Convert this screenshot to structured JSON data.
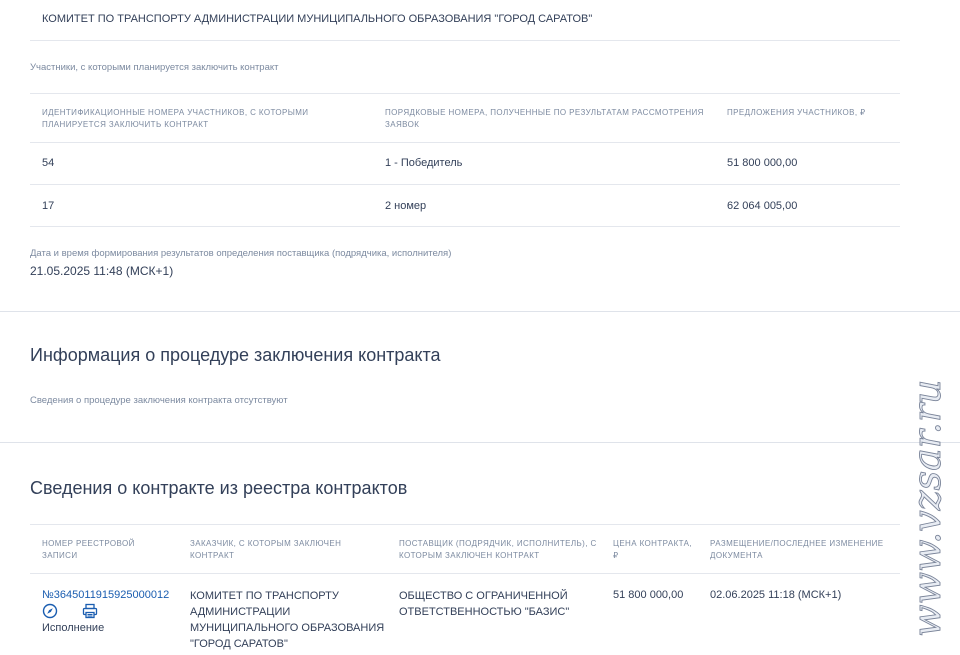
{
  "customer": {
    "name": "КОМИТЕТ ПО ТРАНСПОРТУ АДМИНИСТРАЦИИ МУНИЦИПАЛЬНОГО ОБРАЗОВАНИЯ \"ГОРОД САРАТОВ\""
  },
  "participants": {
    "section_label": "Участники, с которыми планируется заключить контракт",
    "columns": [
      "ИДЕНТИФИКАЦИОННЫЕ НОМЕРА УЧАСТНИКОВ, С КОТОРЫМИ ПЛАНИРУЕТСЯ ЗАКЛЮЧИТЬ КОНТРАКТ",
      "ПОРЯДКОВЫЕ НОМЕРА, ПОЛУЧЕННЫЕ ПО РЕЗУЛЬТАТАМ РАССМОТРЕНИЯ ЗАЯВОК",
      "ПРЕДЛОЖЕНИЯ УЧАСТНИКОВ, ₽"
    ],
    "rows": [
      {
        "id": "54",
        "order": "1 - Победитель",
        "offer": "51 800 000,00"
      },
      {
        "id": "17",
        "order": "2 номер",
        "offer": "62 064 005,00"
      }
    ]
  },
  "results": {
    "label": "Дата и время формирования результатов определения поставщика (подрядчика, исполнителя)",
    "value": "21.05.2025 11:48 (МСК+1)"
  },
  "procedure": {
    "title": "Информация о процедуре заключения контракта",
    "note": "Сведения о процедуре заключения контракта отсутствуют"
  },
  "registry": {
    "title": "Сведения о контракте из реестра контрактов",
    "columns": [
      "НОМЕР РЕЕСТРОВОЙ ЗАПИСИ",
      "ЗАКАЗЧИК, С КОТОРЫМ ЗАКЛЮЧЕН КОНТРАКТ",
      "ПОСТАВЩИК (ПОДРЯДЧИК, ИСПОЛНИТЕЛЬ), С КОТОРЫМ ЗАКЛЮЧЕН КОНТРАКТ",
      "ЦЕНА КОНТРАКТА, ₽",
      "РАЗМЕЩЕНИЕ/ПОСЛЕДНЕЕ ИЗМЕНЕНИЕ ДОКУМЕНТА"
    ],
    "row": {
      "number": "№3645011915925000012",
      "status": "Исполнение",
      "customer": "КОМИТЕТ ПО ТРАНСПОРТУ АДМИНИСТРАЦИИ МУНИЦИПАЛЬНОГО ОБРАЗОВАНИЯ \"ГОРОД САРАТОВ\"",
      "supplier": "ОБЩЕСТВО С ОГРАНИЧЕННОЙ ОТВЕТСТВЕННОСТЬЮ \"БАЗИС\"",
      "price": "51 800 000,00",
      "date": "02.06.2025 11:18 (МСК+1)"
    },
    "icons": [
      "compass-icon",
      "print-icon"
    ]
  },
  "watermark": {
    "text": "www.vzsar.ru"
  },
  "colors": {
    "text": "#334059",
    "muted": "#7c8aa0",
    "link": "#1a5db0",
    "divider": "#e4e7ed"
  }
}
